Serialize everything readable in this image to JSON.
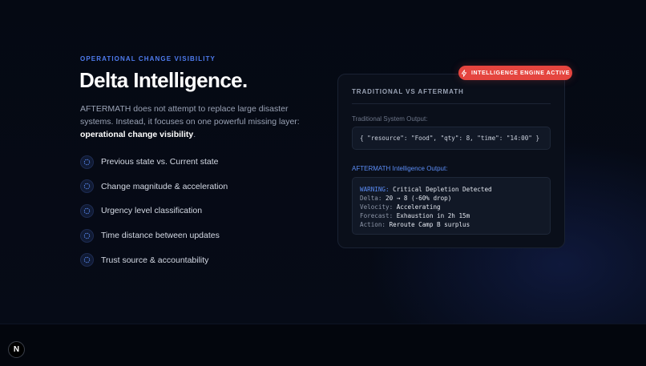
{
  "hero": {
    "eyebrow": "OPERATIONAL CHANGE VISIBILITY",
    "title": "Delta Intelligence.",
    "description_lead": "AFTERMATH does not attempt to replace large disaster systems. Instead, it focuses on one powerful missing layer: ",
    "description_emphasis": "operational change visibility",
    "description_tail": "."
  },
  "features": [
    {
      "icon": "circle-dashed-icon",
      "label": "Previous state vs. Current state"
    },
    {
      "icon": "circle-dashed-icon",
      "label": "Change magnitude & acceleration"
    },
    {
      "icon": "circle-dashed-icon",
      "label": "Urgency level classification"
    },
    {
      "icon": "circle-dashed-icon",
      "label": "Time distance between updates"
    },
    {
      "icon": "circle-dashed-icon",
      "label": "Trust source & accountability"
    }
  ],
  "badge": {
    "icon": "zap-icon",
    "label": "INTELLIGENCE ENGINE ACTIVE"
  },
  "panel": {
    "title": "TRADITIONAL VS AFTERMATH",
    "traditional_label": "Traditional System Output:",
    "traditional_code": "{ \"resource\": \"Food\", \"qty\": 8, \"time\": \"14:00\" }",
    "aftermath_label": "AFTERMATH Intelligence Output:",
    "aftermath_lines": [
      {
        "key": "WARNING:",
        "value": "Critical Depletion Detected"
      },
      {
        "key": "Delta:",
        "value": "20 → 8 (-60% drop)"
      },
      {
        "key": "Velocity:",
        "value": "Accelerating"
      },
      {
        "key": "Forecast:",
        "value": "Exhaustion in 2h 15m"
      },
      {
        "key": "Action:",
        "value": "Reroute Camp B surplus"
      }
    ]
  },
  "footer": {
    "logo_letter": "N"
  },
  "colors": {
    "background": "#050913",
    "accent_blue": "#4f7cf0",
    "badge_red": "#e5453f",
    "panel_bg": "#0a0f1a"
  }
}
